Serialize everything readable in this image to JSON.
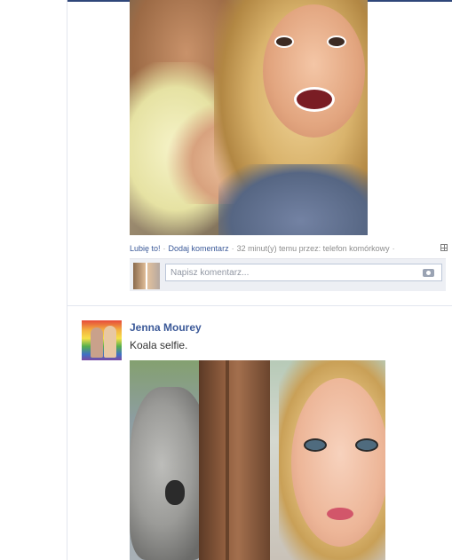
{
  "post1": {
    "actions": {
      "like": "Lubię to!",
      "comment": "Dodaj komentarz",
      "meta": "32 minut(y) temu przez: telefon komórkowy"
    },
    "comment_box": {
      "placeholder": "Napisz komentarz..."
    }
  },
  "post2": {
    "author": "Jenna Mourey",
    "text": "Koala selfie."
  },
  "colors": {
    "link": "#3b5998",
    "meta_text": "#8d8d8d",
    "comment_bg": "#edeff4",
    "topbar": "#2f477a"
  }
}
